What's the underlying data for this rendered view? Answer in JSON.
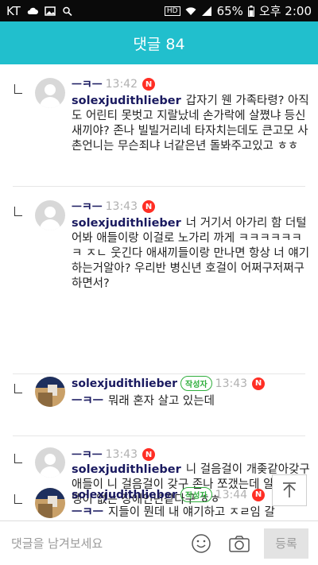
{
  "status_bar": {
    "carrier": "KT",
    "battery": "65%",
    "time": "오후 2:00",
    "hd": "HD"
  },
  "header": {
    "title": "댓글 84"
  },
  "comments": [
    {
      "author": "ㅡㅋㅡ",
      "time": "13:42",
      "badge": "N",
      "reply_to": "solexjudithlieber",
      "text": "갑자기 웬 가족타령? 아직도 어린티 못벗고 지랄났네 손가락에 살쪘냐 등신새끼야? 존나 빌빌거리네 타자치는데도 큰고모 사촌언니는 무슨죄냐 너같은년 돌봐주고있고 ㅎㅎ"
    },
    {
      "author": "ㅡㅋㅡ",
      "time": "13:43",
      "badge": "N",
      "reply_to": "solexjudithlieber",
      "text": "너 거기서 아가리 함 더털어봐 애들이랑 이걸로 노가리 까게 ㅋㅋㅋㅋㅋㅋㅋ ㅈㄴ 웃긴다 애새끼들이랑 만나면 항상 너 얘기하는거알아? 우리반 병신년 호걸이 어쩌구저쩌구하면서?"
    },
    {
      "author": "solexjudithlieber",
      "writer_badge": "작성자",
      "time": "13:43",
      "badge": "N",
      "reply_to": "ㅡㅋㅡ",
      "text": "뭐래 혼자 살고 있는데"
    },
    {
      "author": "ㅡㅋㅡ",
      "time": "13:43",
      "badge": "N",
      "reply_to": "solexjudithlieber",
      "text": "니 걸음걸이 개좆같아갖구 애들이 니 걸음걸이 갖구 존나 쪼갰는데 알아? 궁댕이 없는 장애인년같다구 ㅎㅎ"
    },
    {
      "author": "solexjudithlieber",
      "writer_badge": "작성자",
      "time": "13:44",
      "badge": "N",
      "reply_to": "ㅡㅋㅡ",
      "text": "지들이 뭔데 내 얘기하고 ㅈㄹ임 갈"
    }
  ],
  "footer": {
    "placeholder": "댓글을 남겨보세요",
    "submit": "등록"
  }
}
